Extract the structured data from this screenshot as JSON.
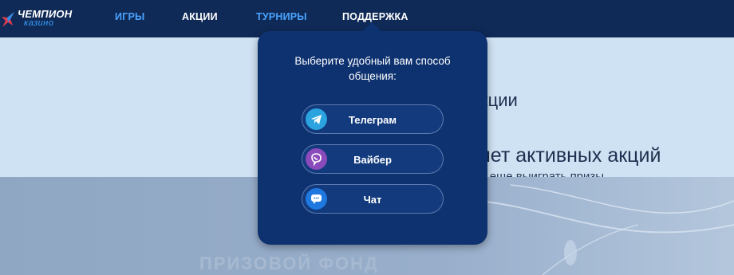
{
  "logo": {
    "title": "ЧЕМПИОН",
    "subtitle": "казино"
  },
  "nav": {
    "games": "ИГРЫ",
    "promotions": "АКЦИИ",
    "tournaments": "ТУРНИРЫ",
    "support": "ПОДДЕРЖКА"
  },
  "banner": {
    "heading_partial": "кции",
    "no_promos_partial": "нет активных акций",
    "sub_partial": "к еще выиграть призы"
  },
  "bottom": {
    "prize_fund": "ПРИЗОВОЙ ФОНД"
  },
  "support_popup": {
    "title": "Выберите удобный вам способ общения:",
    "buttons": [
      {
        "label": "Телеграм",
        "icon": "telegram-icon"
      },
      {
        "label": "Вайбер",
        "icon": "viber-icon"
      },
      {
        "label": "Чат",
        "icon": "chat-icon"
      }
    ]
  },
  "colors": {
    "topbar": "#0f2a57",
    "nav_accent": "#4aa3ff",
    "popup_bg": "#0e3270",
    "telegram": "#2aa3df",
    "viber": "#8c4bbb",
    "chat": "#1e78e0"
  }
}
